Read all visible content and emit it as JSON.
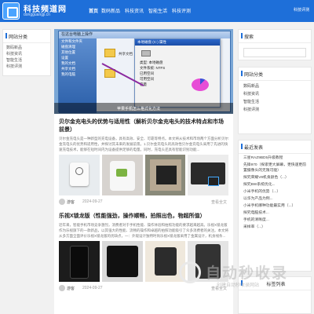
{
  "header": {
    "site_title": "科技频道网",
    "site_domain": "dongguangji.cn",
    "nav": [
      "首页",
      "数码新品",
      "科技资讯",
      "智能生活",
      "科技评测"
    ],
    "right_link": "科技评测",
    "brand_color": "#1e6fd9"
  },
  "left_sidebar": {
    "title": "网站分类",
    "items": [
      "数码新品",
      "科技资讯",
      "智能生活",
      "科技评测"
    ]
  },
  "featured": {
    "caption": "苹果手机怎么格式化方法",
    "window_title": "在这台电脑上操作",
    "window_items": [
      "文件和文件夹",
      "磁盘清理",
      "其他位置",
      "设置",
      "我的文档",
      "共享文档",
      "我的电脑"
    ],
    "dialog_title": "本地磁盘 (C:) 属性",
    "dialog_rows": [
      "类型: 本地磁盘",
      "文件系统: NTFS",
      "已用空间",
      "可用空间",
      "容量"
    ],
    "folder_label": "共享文档"
  },
  "articles": [
    {
      "title": "贝尔金充电头的优势与适用性（解析贝尔金充电头的技术特点和市场前景）",
      "excerpt": "贝尔金充电头是一种新型的充电设备，具有高效、安全、可靠等特点。本文将从技术和市场两个方面分析贝尔金充电头的优势和适用性，并探讨其未来的发展前景。1.贝尔金充电头的高效性贝尔金充电头采用了先进的快速充电技术，能够在短时间内为设备提供足够的电量。同时，充电头还具有智能识别功能...",
      "author": "游客",
      "date": "2024-09-27",
      "more": "查看全文"
    },
    {
      "title": "乐视X锁龙版（性能强劲，操作顺畅，拍照出色，物超所值）",
      "excerpt": "近年来，智能手机市场竞争激烈，消费者对于手机性能、操作体验和拍照功能的要求越来越高。乐视X锁龙版作为乐视旗下的一款新品，以其强大的性能、流畅的操作和卓越的拍照功能吸引了众多消费者的关注。本文将从多方面全面评价乐视X锁龙版的优缺点，一：外观设计独特时尚乐视X锁龙版采用了金属设计，机身线条...",
      "author": "游客",
      "date": "2024-09-27",
      "more": "查看全文"
    }
  ],
  "right_sidebar": {
    "search_title": "搜索",
    "category_title": "网站分类",
    "categories": [
      "数码新品",
      "科技资讯",
      "智能生活",
      "科技评测"
    ],
    "recent_title": "最近发表",
    "recent": [
      "三星RAZ9BD5升级教程",
      "先锋970（探索更大屏幕，更快速更前置摄像头的无限可能）",
      "探究荣耀V8机身颜色（...）",
      "探究BW系统优化...",
      "小米手机的优势（...）",
      "以华为产品为例...",
      "小米手机哪种功能最实用（...）",
      "探究电脑技术...",
      "手机的清晰度...",
      "采样率（...）"
    ],
    "tags_title": "标签列表"
  },
  "watermark": {
    "text": "自动秒收录",
    "sub": "创建自动秒收录网站"
  }
}
